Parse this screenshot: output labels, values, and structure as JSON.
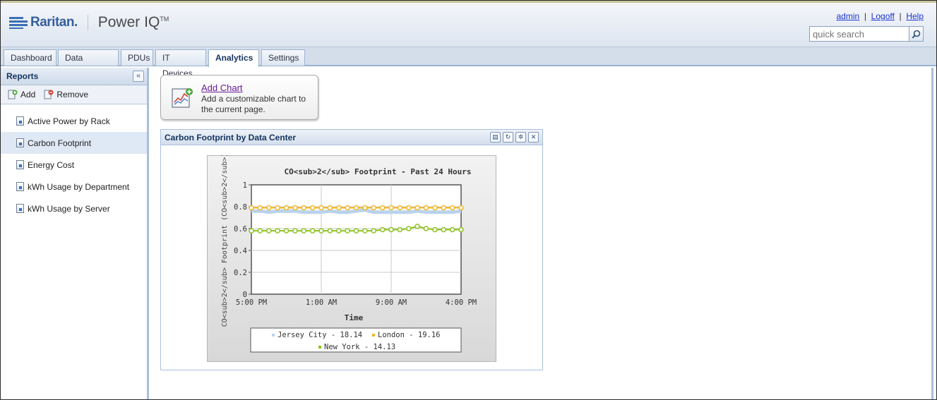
{
  "header": {
    "brand": "Raritan.",
    "product": "Power IQ",
    "product_tm": "TM",
    "links": {
      "admin": "admin",
      "logoff": "Logoff",
      "help": "Help"
    },
    "search_placeholder": "quick search"
  },
  "tabs": [
    {
      "label": "Dashboard"
    },
    {
      "label": "Data Centers"
    },
    {
      "label": "PDUs"
    },
    {
      "label": "IT Devices"
    },
    {
      "label": "Analytics",
      "active": true
    },
    {
      "label": "Settings"
    }
  ],
  "sidebar": {
    "title": "Reports",
    "add_label": "Add",
    "remove_label": "Remove",
    "items": [
      {
        "label": "Active Power by Rack"
      },
      {
        "label": "Carbon Footprint",
        "selected": true
      },
      {
        "label": "Energy Cost"
      },
      {
        "label": "kWh Usage by Department"
      },
      {
        "label": "kWh Usage by Server"
      }
    ]
  },
  "add_chart": {
    "link": "Add Chart",
    "description": "Add a customizable chart to the current page."
  },
  "panel": {
    "title": "Carbon Footprint by Data Center"
  },
  "colors": {
    "jersey": "#b9d3ee",
    "london": "#f3b728",
    "newyork": "#8ec21f"
  },
  "chart_data": {
    "type": "line",
    "title": "CO<sub>2</sub> Footprint - Past 24 Hours",
    "xlabel": "Time",
    "ylabel": "CO<sub>2</sub> Footprint (CO<sub>2</sub>)",
    "ylim": [
      0,
      1
    ],
    "yticks": [
      "0",
      "0.2",
      "0.4",
      "0.6",
      "0.8",
      "1"
    ],
    "xticks": [
      "5:00 PM",
      "1:00 AM",
      "9:00 AM",
      "4:00 PM"
    ],
    "grid": true,
    "legend_position": "bottom",
    "series": [
      {
        "name": "Jersey City - 18.14",
        "color": "#b9d3ee",
        "values": [
          0.76,
          0.76,
          0.75,
          0.76,
          0.76,
          0.76,
          0.75,
          0.75,
          0.75,
          0.76,
          0.75,
          0.75,
          0.76,
          0.77,
          0.75,
          0.75,
          0.75,
          0.75,
          0.75,
          0.76,
          0.75,
          0.75,
          0.75,
          0.75,
          0.76
        ]
      },
      {
        "name": "London - 19.16",
        "color": "#f3b728",
        "values": [
          0.79,
          0.79,
          0.79,
          0.79,
          0.79,
          0.79,
          0.79,
          0.79,
          0.79,
          0.79,
          0.79,
          0.79,
          0.79,
          0.79,
          0.79,
          0.79,
          0.79,
          0.79,
          0.79,
          0.79,
          0.79,
          0.79,
          0.79,
          0.79,
          0.79
        ]
      },
      {
        "name": "New York - 14.13",
        "color": "#8ec21f",
        "values": [
          0.58,
          0.58,
          0.58,
          0.58,
          0.58,
          0.58,
          0.58,
          0.58,
          0.58,
          0.58,
          0.58,
          0.58,
          0.58,
          0.58,
          0.58,
          0.59,
          0.59,
          0.59,
          0.6,
          0.62,
          0.6,
          0.59,
          0.59,
          0.59,
          0.59
        ]
      }
    ]
  }
}
